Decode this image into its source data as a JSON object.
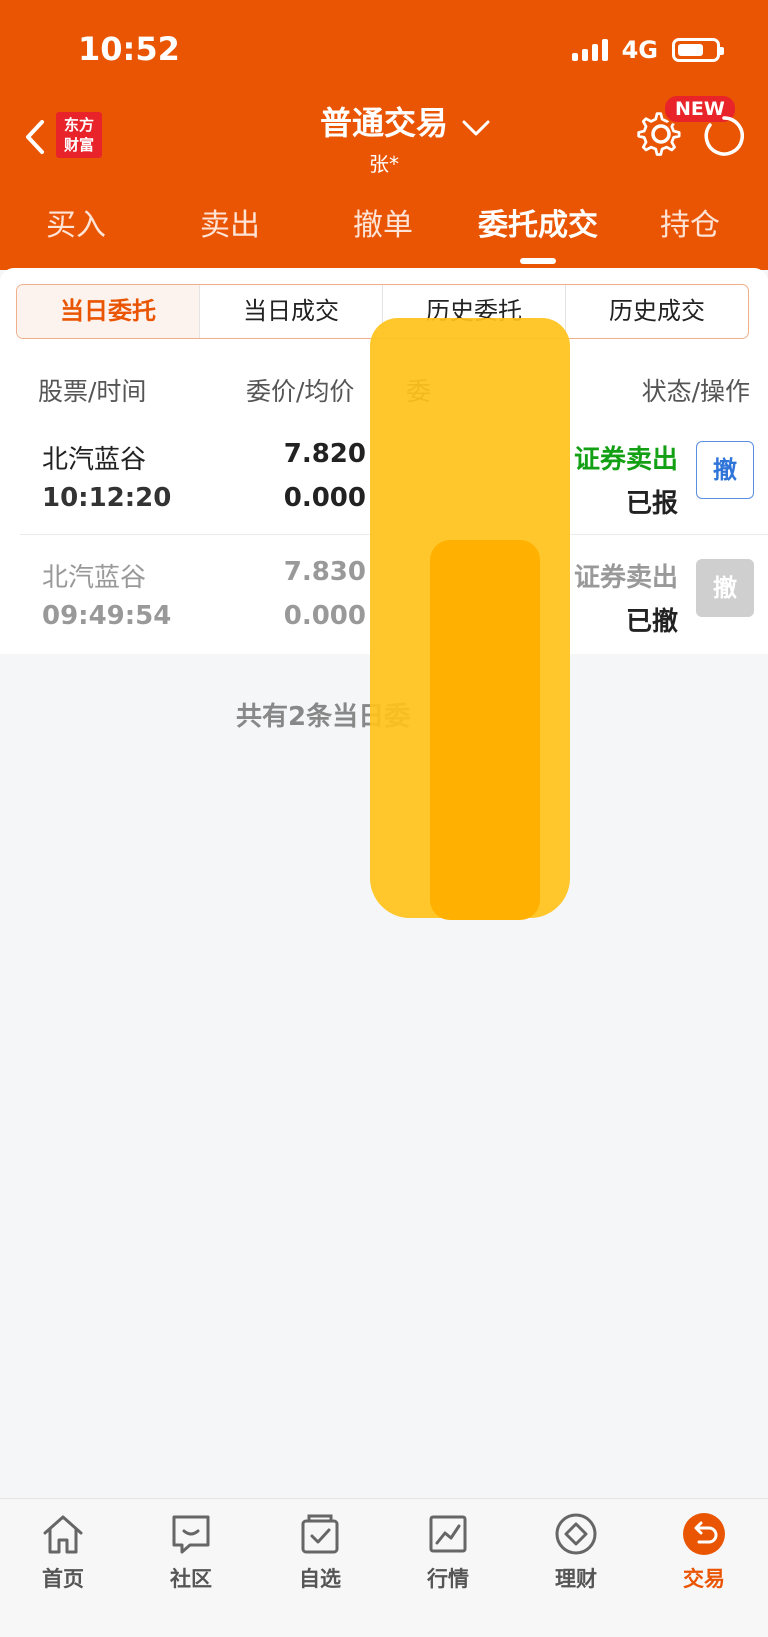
{
  "status_bar": {
    "time": "10:52",
    "network": "4G"
  },
  "header": {
    "logo_line1": "东方",
    "logo_line2": "财富",
    "title": "普通交易",
    "account": "张*",
    "new_badge": "NEW"
  },
  "tabs": [
    {
      "label": "买入"
    },
    {
      "label": "卖出"
    },
    {
      "label": "撤单"
    },
    {
      "label": "委托成交"
    },
    {
      "label": "持仓"
    }
  ],
  "segments": [
    {
      "label": "当日委托"
    },
    {
      "label": "当日成交"
    },
    {
      "label": "历史委托"
    },
    {
      "label": "历史成交"
    }
  ],
  "columns": {
    "stock_time": "股票/时间",
    "price_avg": "委价/均价",
    "partial": "委",
    "status_action": "状态/操作"
  },
  "orders": [
    {
      "name": "北汽蓝谷",
      "time": "10:12:20",
      "price": "7.820",
      "avg": "0.000",
      "type": "证券卖出",
      "status": "已报",
      "action": "撤"
    },
    {
      "name": "北汽蓝谷",
      "time": "09:49:54",
      "price": "7.830",
      "avg": "0.000",
      "type": "证券卖出",
      "status": "已撤",
      "action": "撤"
    }
  ],
  "summary": "共有2条当日委",
  "tabbar": [
    {
      "label": "首页",
      "icon": "home-icon"
    },
    {
      "label": "社区",
      "icon": "chat-icon"
    },
    {
      "label": "自选",
      "icon": "watchlist-icon"
    },
    {
      "label": "行情",
      "icon": "chart-icon"
    },
    {
      "label": "理财",
      "icon": "diamond-icon"
    },
    {
      "label": "交易",
      "icon": "trade-icon"
    }
  ],
  "colors": {
    "brand": "#ea5504",
    "sell": "#14a014",
    "cancel": "#2f74d8"
  }
}
